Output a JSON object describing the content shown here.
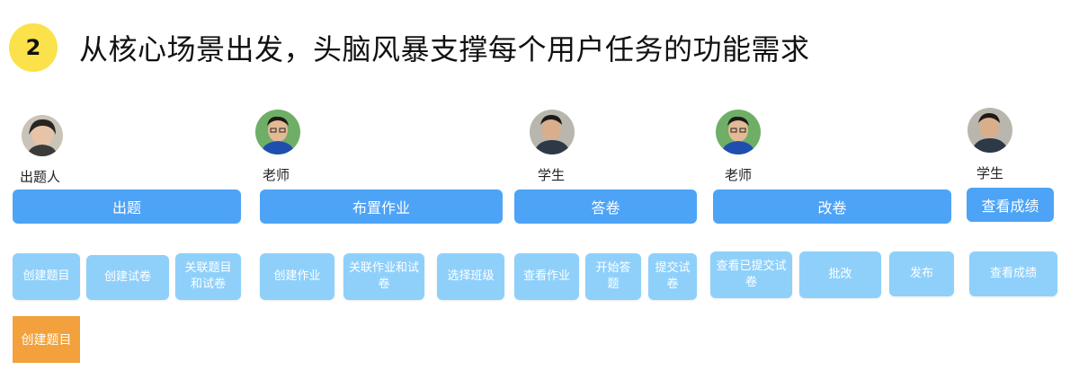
{
  "header": {
    "step_number": "2",
    "title": "从核心场景出发，头脑风暴支撑每个用户任务的功能需求"
  },
  "roles": [
    "出题人",
    "老师",
    "学生",
    "老师",
    "学生"
  ],
  "phases": [
    "出题",
    "布置作业",
    "答卷",
    "改卷",
    "查看成绩"
  ],
  "tasks": {
    "p0": [
      "创建题目",
      "创建试卷",
      "关联题目和试卷"
    ],
    "p1": [
      "创建作业",
      "关联作业和试卷",
      "选择班级"
    ],
    "p2": [
      "查看作业",
      "开始答题",
      "提交试卷"
    ],
    "p3": [
      "查看已提交试卷",
      "批改",
      "发布"
    ],
    "p4": [
      "查看成绩"
    ]
  },
  "sticky_note": "创建题目",
  "colors": {
    "phase": "#4da3f6",
    "task": "#8fd0fb",
    "sticky": "#f2a13c",
    "badge": "#fbe14a"
  }
}
